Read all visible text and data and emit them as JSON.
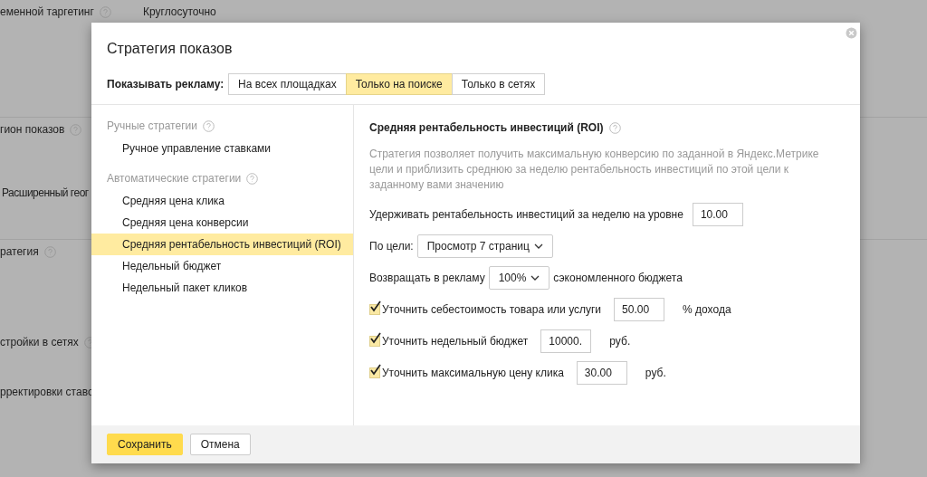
{
  "background": {
    "rows": [
      {
        "label": "еменной таргетинг",
        "help": true,
        "value": "Круглосуточно",
        "divider_after": true
      },
      {
        "label": "гион показов",
        "help": true,
        "divider_after": false
      },
      {
        "label": "Расширенный геог",
        "divider_after": true
      },
      {
        "label": "ратегия",
        "help": true,
        "divider_after": false
      },
      {
        "label": "стройки в сетях",
        "help": true,
        "divider_after": false
      },
      {
        "label": "рректировки ставо",
        "divider_after": false
      }
    ]
  },
  "dialog": {
    "title": "Стратегия показов",
    "show_ads_label": "Показывать рекламу:",
    "tabs": [
      {
        "label": "На всех площадках",
        "selected": false
      },
      {
        "label": "Только на поиске",
        "selected": true
      },
      {
        "label": "Только в сетях",
        "selected": false
      }
    ],
    "strategy_groups": [
      {
        "title": "Ручные стратегии",
        "items": [
          {
            "label": "Ручное управление ставками",
            "selected": false
          }
        ]
      },
      {
        "title": "Автоматические стратегии",
        "items": [
          {
            "label": "Средняя цена клика",
            "selected": false
          },
          {
            "label": "Средняя цена конверсии",
            "selected": false
          },
          {
            "label": "Средняя рентабельность инвестиций (ROI)",
            "selected": true
          },
          {
            "label": "Недельный бюджет",
            "selected": false
          },
          {
            "label": "Недельный пакет кликов",
            "selected": false
          }
        ]
      }
    ],
    "detail": {
      "heading": "Средняя рентабельность инвестиций (ROI)",
      "description": "Стратегия позволяет получить максимальную конверсию по заданной в Яндекс.Метрике цели и приблизить среднюю за неделю рентабельность инвестиций по этой цели к заданному вами значению",
      "fields": [
        {
          "kind": "input",
          "label": "Удерживать рентабельность инвестиций за неделю на уровне",
          "value": "10.00"
        },
        {
          "kind": "select",
          "label": "По цели:",
          "value": "Просмотр 7 страниц"
        },
        {
          "kind": "select",
          "label": "Возвращать в рекламу",
          "value": "100%",
          "suffix": "сэкономленного бюджета"
        },
        {
          "kind": "checkbox",
          "label": "Уточнить себестоимость товара или услуги",
          "checked": true,
          "value": "50.00",
          "suffix": "% дохода"
        },
        {
          "kind": "checkbox",
          "label": "Уточнить недельный бюджет",
          "checked": true,
          "value": "10000.",
          "suffix": "руб."
        },
        {
          "kind": "checkbox",
          "label": "Уточнить максимальную цену клика",
          "checked": true,
          "value": "30.00",
          "suffix": "руб."
        }
      ]
    },
    "buttons": [
      {
        "kind": "primary",
        "label": "Сохранить"
      },
      {
        "kind": "secondary",
        "label": "Отмена"
      }
    ]
  }
}
